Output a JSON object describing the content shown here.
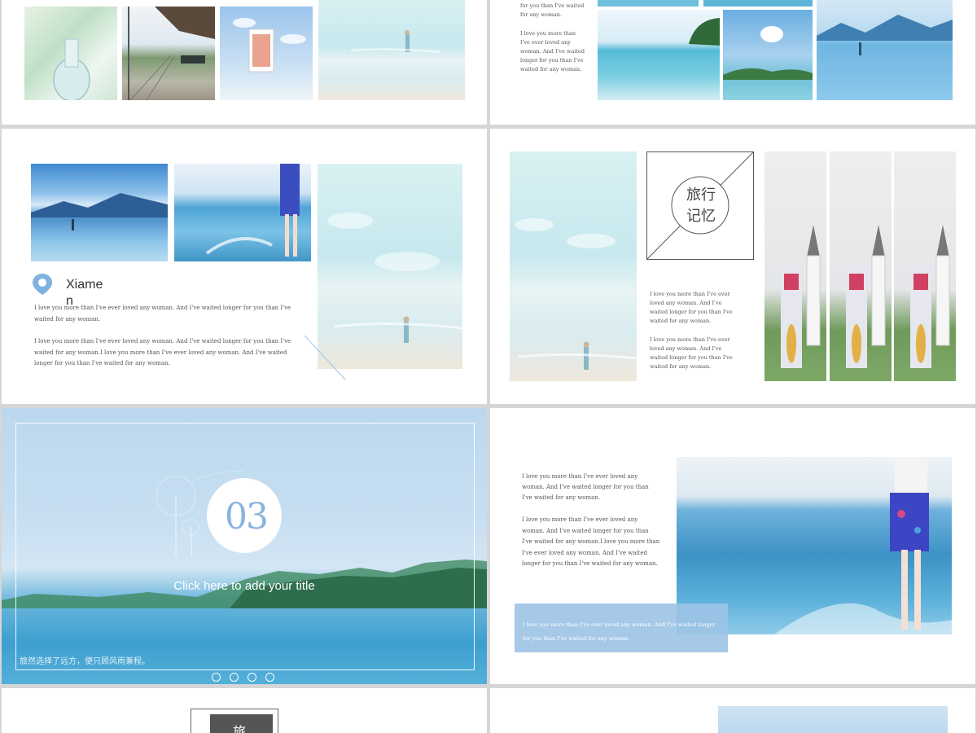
{
  "slide_r2_left": {
    "place": "Xiame",
    "place_wrap": "n",
    "p1": "I love you more than I've ever loved any woman. And I've waited longer for you than I've waited for any woman.",
    "p2": "I love you more than I've ever loved any woman. And I've waited longer for you than I've waited for any woman.I love you more than I've ever loved any woman. And I've waited longer for you than I've waited for any woman."
  },
  "slide_r1_right": {
    "p0": "for you than I've waited for any woman.",
    "p1": "I love you more than I've ever loved any woman. And I've waited longer for you than I've waited for any woman."
  },
  "slide_r2_right": {
    "title_line1": "旅行",
    "title_line2": "记忆",
    "p1": "I love you more than I've ever loved any woman. And I've waited longer for you than I've waited for any woman.",
    "p2": "I love you more than I've ever loved any woman. And I've waited longer for you than I've waited for any woman."
  },
  "slide_r3_left": {
    "number": "03",
    "title": "Click here to add your title",
    "subtitle": "旅然选择了远方，便只顾风雨兼程。"
  },
  "slide_r3_right": {
    "p1": "I love you more than I've ever loved any woman. And I've waited longer for you than I've waited for any woman.",
    "p2": "I love you more than I've ever loved any woman. And I've waited longer for you than I've waited for any woman.I love you more than I've ever loved any woman. And I've waited longer for you than I've waited for any woman.",
    "box": "I love you more than I've ever loved any woman. And I've waited longer for you than I've waited for any woman."
  },
  "slide_r4_left": {
    "title_char": "旅"
  },
  "colors": {
    "accent_blue": "#9cc3e6",
    "pin_blue": "#7eb2e0",
    "sky_blue": "#bcd8ee"
  }
}
